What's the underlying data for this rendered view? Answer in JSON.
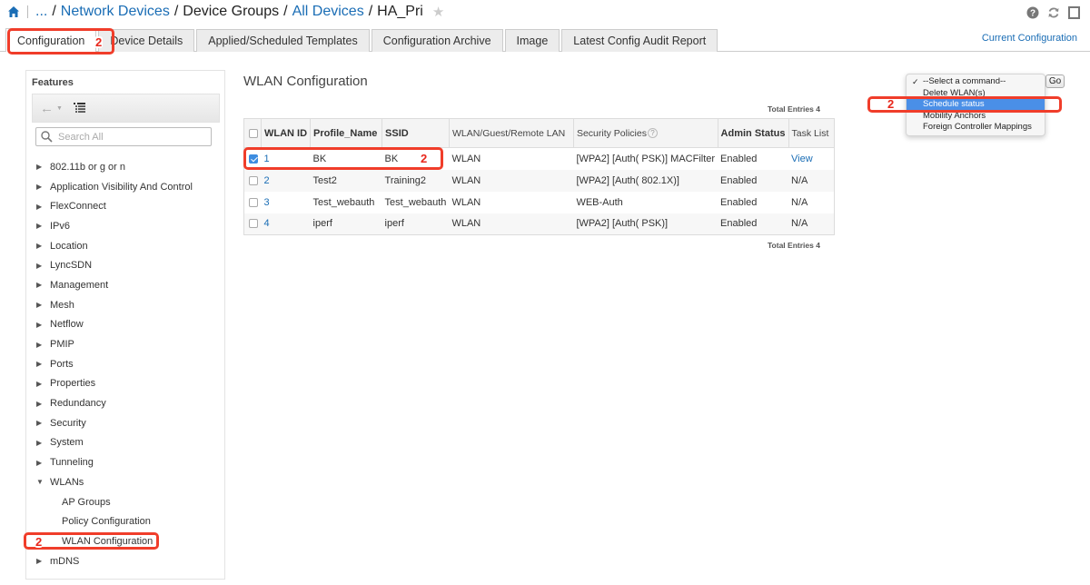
{
  "breadcrumb": {
    "ellipsis": "...",
    "items": [
      "Network Devices",
      "Device Groups",
      "All Devices",
      "HA_Pri"
    ],
    "separator": "/"
  },
  "header_icons": [
    "help-icon",
    "refresh-icon",
    "window-icon"
  ],
  "tabs": [
    {
      "label": "Configuration",
      "active": true
    },
    {
      "label": "Device Details",
      "active": false
    },
    {
      "label": "Applied/Scheduled Templates",
      "active": false
    },
    {
      "label": "Configuration Archive",
      "active": false
    },
    {
      "label": "Image",
      "active": false
    },
    {
      "label": "Latest Config Audit Report",
      "active": false
    }
  ],
  "current_configuration_link": "Current Configuration",
  "sidebar": {
    "title": "Features",
    "search_placeholder": "Search All",
    "items": [
      {
        "label": "802.11b or g or n",
        "expanded": false
      },
      {
        "label": "Application Visibility And Control",
        "expanded": false
      },
      {
        "label": "FlexConnect",
        "expanded": false
      },
      {
        "label": "IPv6",
        "expanded": false
      },
      {
        "label": "Location",
        "expanded": false
      },
      {
        "label": "LyncSDN",
        "expanded": false
      },
      {
        "label": "Management",
        "expanded": false
      },
      {
        "label": "Mesh",
        "expanded": false
      },
      {
        "label": "Netflow",
        "expanded": false
      },
      {
        "label": "PMIP",
        "expanded": false
      },
      {
        "label": "Ports",
        "expanded": false
      },
      {
        "label": "Properties",
        "expanded": false
      },
      {
        "label": "Redundancy",
        "expanded": false
      },
      {
        "label": "Security",
        "expanded": false
      },
      {
        "label": "System",
        "expanded": false
      },
      {
        "label": "Tunneling",
        "expanded": false
      },
      {
        "label": "WLANs",
        "expanded": true
      },
      {
        "label": "mDNS",
        "expanded": false
      }
    ],
    "wlan_children": [
      "AP Groups",
      "Policy Configuration",
      "WLAN Configuration"
    ]
  },
  "main": {
    "title": "WLAN Configuration",
    "total_entries_label": "Total Entries 4",
    "columns": [
      "WLAN ID",
      "Profile_Name",
      "SSID",
      "WLAN/Guest/Remote LAN",
      "Security Policies",
      "Admin Status",
      "Task List"
    ],
    "rows": [
      {
        "checked": true,
        "id": "1",
        "profile": "BK",
        "ssid": "BK",
        "type": "WLAN",
        "security": "[WPA2] [Auth( PSK)] MACFilter",
        "status": "Enabled",
        "task": "View"
      },
      {
        "checked": false,
        "id": "2",
        "profile": "Test2",
        "ssid": "Training2",
        "type": "WLAN",
        "security": "[WPA2] [Auth( 802.1X)]",
        "status": "Enabled",
        "task": "N/A"
      },
      {
        "checked": false,
        "id": "3",
        "profile": "Test_webauth",
        "ssid": "Test_webauth",
        "type": "WLAN",
        "security": "WEB-Auth",
        "status": "Enabled",
        "task": "N/A"
      },
      {
        "checked": false,
        "id": "4",
        "profile": "iperf",
        "ssid": "iperf",
        "type": "WLAN",
        "security": "[WPA2] [Auth( PSK)]",
        "status": "Enabled",
        "task": "N/A"
      }
    ]
  },
  "command_menu": {
    "options": [
      "--Select a command--",
      "Delete WLAN(s)",
      "Schedule status",
      "Mobility Anchors",
      "Foreign Controller Mappings"
    ],
    "checked_option": "--Select a command--",
    "highlighted_option": "Schedule status",
    "go_label": "Go"
  },
  "annotations": {
    "step_label": "2",
    "color": "#f03d2a"
  },
  "colors": {
    "link": "#1a6db5",
    "highlight": "#4a8fe7"
  }
}
